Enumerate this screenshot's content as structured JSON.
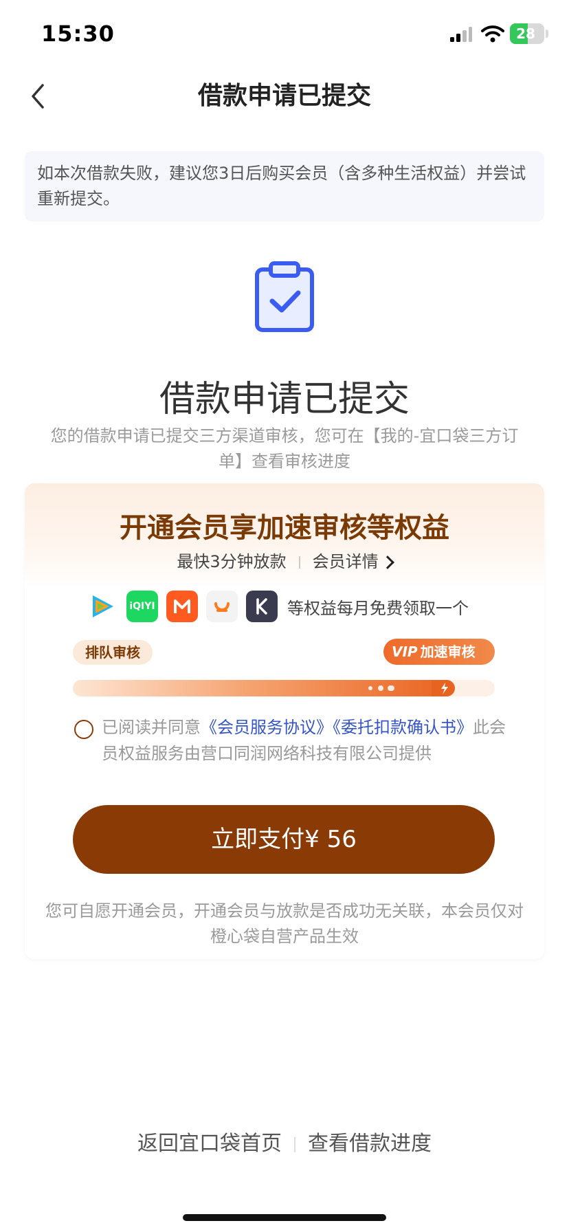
{
  "status_bar": {
    "time": "15:30",
    "battery": "28",
    "battery_level": 0.28
  },
  "nav": {
    "title": "借款申请已提交"
  },
  "notice": {
    "text": "如本次借款失败，建议您3日后购买会员（含多种生活权益）并尝试重新提交。"
  },
  "main": {
    "title": "借款申请已提交",
    "subtitle": "您的借款申请已提交三方渠道审核，您可在【我的-宜口袋三方订单】查看审核进度"
  },
  "member_card": {
    "title": "开通会员享加速审核等权益",
    "fast_release": "最快3分钟放款",
    "details_link": "会员详情",
    "apps": [
      {
        "name": "tencent-video",
        "label": ""
      },
      {
        "name": "iqiyi",
        "label": "iQIYI"
      },
      {
        "name": "mango-tv",
        "label": ""
      },
      {
        "name": "didi",
        "label": ""
      },
      {
        "name": "kuaishou",
        "label": ""
      }
    ],
    "apps_text": "等权益每月免费领取一个",
    "queue_label": "排队审核",
    "vip_badge": "VIP",
    "vip_label": "加速审核",
    "agreement_prefix": "已阅读并同意",
    "agreement_link1": "《会员服务协议》",
    "agreement_link2": "《委托扣款确认书》",
    "agreement_suffix": "此会员权益服务由营口同润网络科技有限公司提供",
    "pay_button": "立即支付¥ 56",
    "disclaimer": "您可自愿开通会员，开通会员与放款是否成功无关联，本会员仅对橙心袋自营产品生效"
  },
  "bottom": {
    "home_link": "返回宜口袋首页",
    "progress_link": "查看借款进度"
  },
  "colors": {
    "brand_brown": "#8a3a05",
    "accent_orange": "#e8631f",
    "link_blue": "#3554c6",
    "icon_blue": "#3a5cf0"
  }
}
